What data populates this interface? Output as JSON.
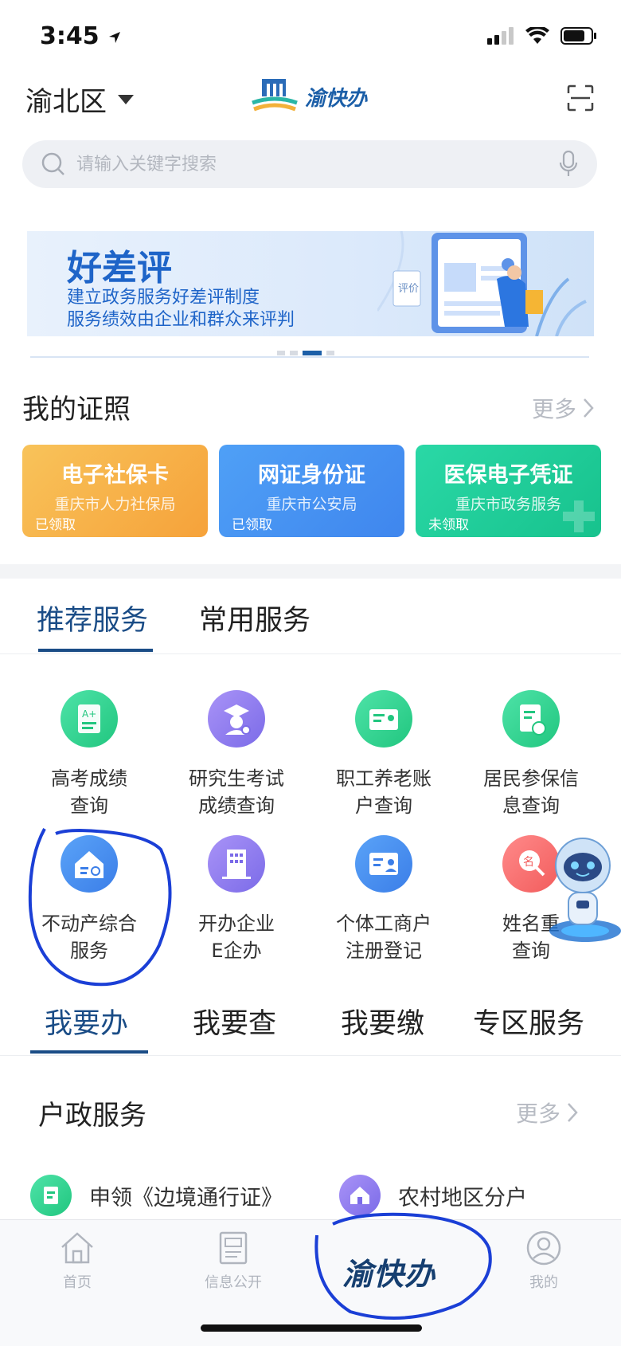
{
  "status_bar": {
    "time": "3:45"
  },
  "header": {
    "region": "渝北区",
    "logo_text": "渝快办"
  },
  "search": {
    "placeholder": "请输入关键字搜索",
    "value": ""
  },
  "banner": {
    "title": "好差评",
    "line1": "建立政务服务好差评制度",
    "line2": "服务绩效由企业和群众来评判",
    "tag": "评价"
  },
  "certificates": {
    "title": "我的证照",
    "more": "更多",
    "cards": [
      {
        "name": "电子社保卡",
        "org": "重庆市人力社保局",
        "state": "已领取"
      },
      {
        "name": "网证身份证",
        "org": "重庆市公安局",
        "state": "已领取"
      },
      {
        "name": "医保电子凭证",
        "org": "重庆市政务服务",
        "state": "未领取"
      }
    ]
  },
  "service_tabs": [
    "推荐服务",
    "常用服务"
  ],
  "services": [
    {
      "line1": "高考成绩",
      "line2": "查询"
    },
    {
      "line1": "研究生考试",
      "line2": "成绩查询"
    },
    {
      "line1": "职工养老账",
      "line2": "户查询"
    },
    {
      "line1": "居民参保信",
      "line2": "息查询"
    },
    {
      "line1": "不动产综合",
      "line2": "服务"
    },
    {
      "line1": "开办企业",
      "line2": "E企办"
    },
    {
      "line1": "个体工商户",
      "line2": "注册登记"
    },
    {
      "line1": "姓名重",
      "line2": "查询"
    }
  ],
  "action_tabs": [
    "我要办",
    "我要查",
    "我要缴",
    "专区服务"
  ],
  "huzheng": {
    "title": "户政服务",
    "more": "更多",
    "items": [
      "申领《边境通行证》",
      "农村地区分户"
    ]
  },
  "bottom_nav": {
    "home": "首页",
    "info": "信息公开",
    "center": "渝快办",
    "mine": "我的"
  },
  "colors": {
    "brand_blue": "#1a4c86",
    "annotation": "#1b3fd6"
  }
}
